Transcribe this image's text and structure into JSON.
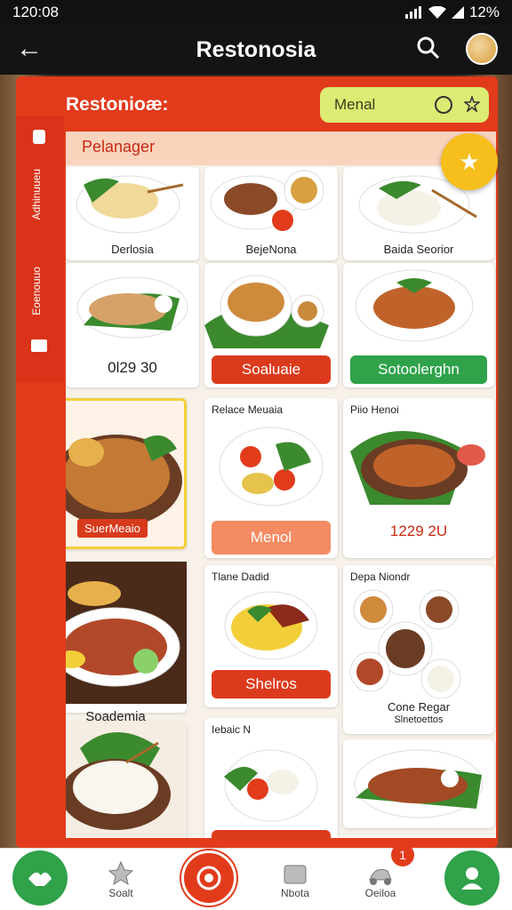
{
  "status": {
    "time": "120:08",
    "battery": "12%"
  },
  "appbar": {
    "title": "Restonosia"
  },
  "panel": {
    "title": "Restonioæ:",
    "search_value": "Menal",
    "side_label_1": "Adhinuueu",
    "side_label_2": "Eoenouuo"
  },
  "section": {
    "title": "Pelanager"
  },
  "cards": {
    "c1": {
      "caption": "Derlosia"
    },
    "c2": {
      "caption": "BejeNona"
    },
    "c3": {
      "caption": "Baida Seorior"
    },
    "c4": {
      "price": "0l29 30"
    },
    "c5": {
      "button": "Soaluaie"
    },
    "c6": {
      "button": "Sotoolerghn"
    },
    "c7": {
      "label": "SuerMeaio"
    },
    "c8": {
      "title": "Relace Meuaia",
      "button": "Menol"
    },
    "c9": {
      "title": "Piio Henoi",
      "price": "1229 2U"
    },
    "c10": {
      "caption": "Soademia"
    },
    "c11": {
      "title": "Tlane Dadid",
      "button": "Shelros"
    },
    "c12": {
      "title": "Depa Niondr",
      "caption": "Cone Regar",
      "subcaption": "Slnetoettos"
    },
    "c14": {
      "title": "Iebaic N"
    }
  },
  "nav": {
    "item2": "Soalt",
    "item4": "Nbota",
    "item5": "Oeiloa",
    "badge": "1"
  },
  "colors": {
    "primary": "#e23b1c",
    "accent": "#f6bf1c",
    "green": "#2fa24a"
  }
}
